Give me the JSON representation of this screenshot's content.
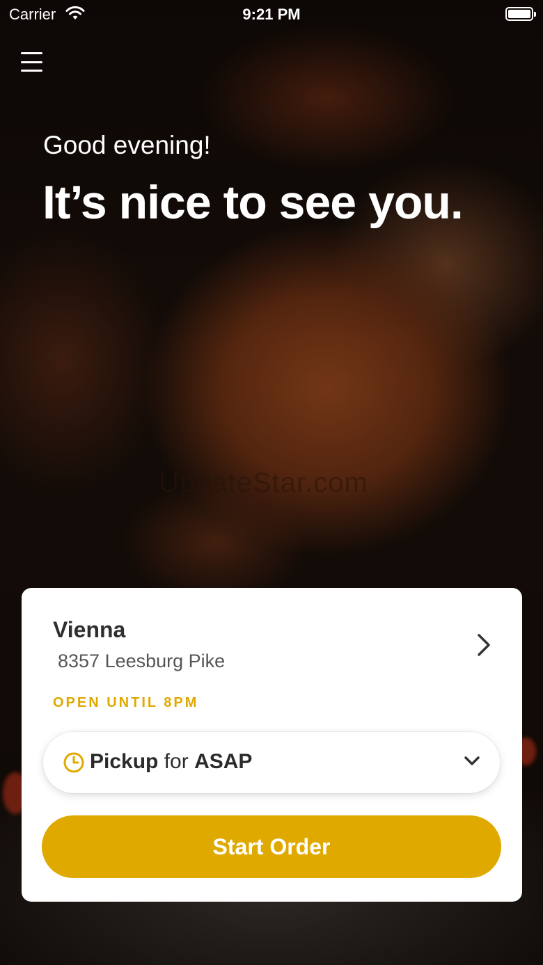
{
  "status_bar": {
    "carrier": "Carrier",
    "time": "9:21 PM"
  },
  "greeting": {
    "salutation": "Good evening!",
    "headline": "It’s nice to see you."
  },
  "watermark": "UpdateStar.com",
  "store": {
    "name": "Vienna",
    "address": "8357 Leesburg Pike",
    "hours": "OPEN UNTIL 8PM"
  },
  "order_mode": {
    "mode": "Pickup",
    "connector": "for",
    "time": "ASAP"
  },
  "actions": {
    "start_order": "Start Order"
  },
  "colors": {
    "accent": "#e0a900"
  },
  "icons": [
    "wifi-icon",
    "battery-icon",
    "menu-icon",
    "chevron-right-icon",
    "clock-icon",
    "chevron-down-icon"
  ]
}
